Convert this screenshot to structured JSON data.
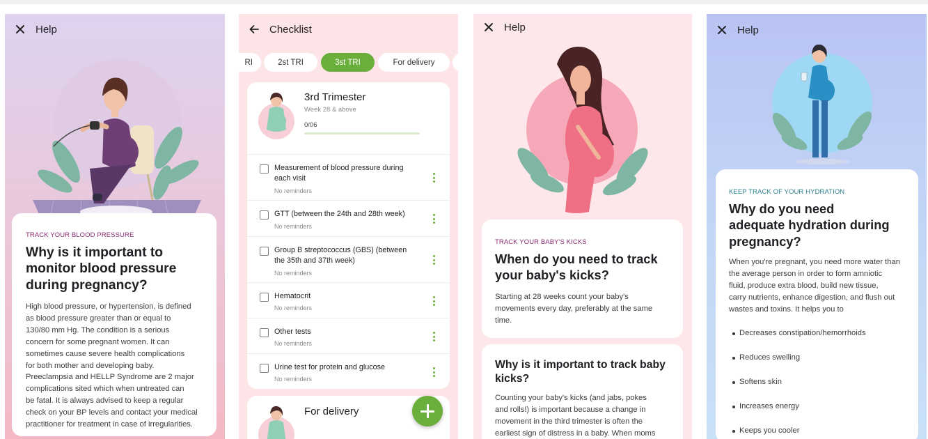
{
  "colors": {
    "green_accent": "#6aae3c",
    "purple_kicker": "#8a2d74",
    "teal_kicker": "#2a7f8f"
  },
  "screen1": {
    "title": "Help",
    "close_icon": "close-icon",
    "kicker": "TRACK YOUR BLOOD PRESSURE",
    "heading": [
      "Why is it important to",
      "monitor blood pressure",
      "during pregnancy?"
    ],
    "body": [
      "High blood pressure, or hypertension, is defined",
      "as blood pressure greater than or equal to",
      "130/80 mm Hg. The condition is a serious",
      "concern for some pregnant women. It can",
      "sometimes cause severe health complications",
      "for both mother and developing baby.",
      "Preeclampsia and HELLP Syndrome are 2 major",
      "complications sited which when untreated can",
      "be fatal. It is always advised to keep a regular",
      "check on your BP levels and contact your medical",
      "practitioner for treatment in case of irregularities."
    ]
  },
  "screen2": {
    "title": "Checklist",
    "back_icon": "arrow-left-icon",
    "tabs": [
      {
        "label": "RI",
        "active": false
      },
      {
        "label": "2st TRI",
        "active": false
      },
      {
        "label": "3st TRI",
        "active": true
      },
      {
        "label": "For delivery",
        "active": false
      }
    ],
    "trimester": {
      "title": "3rd Trimester",
      "subtitle": "Week 28 & above",
      "progress_text": "0/06",
      "progress_fraction": 0
    },
    "items": [
      {
        "title": "Measurement of blood pressure during each visit",
        "lines": [
          "Measurement of blood pressure during",
          "each visit"
        ],
        "reminder": "No reminders"
      },
      {
        "title": "GTT (between the 24th and 28th week)",
        "lines": [
          "GTT (between the 24th and 28th week)"
        ],
        "reminder": "No reminders"
      },
      {
        "title": "Group B streptococcus (GBS) (between the 35th and 37th week)",
        "lines": [
          "Group B streptococcus (GBS) (between",
          "the 35th and 37th week)"
        ],
        "reminder": "No reminders"
      },
      {
        "title": "Hematocrit",
        "lines": [
          "Hematocrit"
        ],
        "reminder": "No reminders"
      },
      {
        "title": "Other tests",
        "lines": [
          "Other tests"
        ],
        "reminder": "No reminders"
      },
      {
        "title": "Urine test for protein and glucose",
        "lines": [
          "Urine test for protein and glucose"
        ],
        "reminder": "No reminders"
      }
    ],
    "delivery_title": "For delivery",
    "fab_icon": "plus-icon"
  },
  "screen3": {
    "title": "Help",
    "close_icon": "close-icon",
    "kicker": "TRACK YOUR BABY'S KICKS",
    "heading": [
      "When do you need to track",
      "your baby's kicks?"
    ],
    "body": [
      "Starting at 28 weeks count your baby's",
      "movements every day, preferably at the same",
      "time."
    ],
    "heading2": [
      "Why is it important to track baby",
      "kicks?"
    ],
    "body2": [
      "Counting your baby's kicks (and jabs, pokes",
      "and rolls!) is important because a change in",
      "movement in the third trimester is often the",
      "earliest sign of distress in a baby. When moms"
    ]
  },
  "screen4": {
    "title": "Help",
    "close_icon": "close-icon",
    "kicker": "KEEP TRACK OF YOUR HYDRATION",
    "heading": [
      "Why do you need",
      "adequate hydration during",
      "pregnancy?"
    ],
    "body": [
      "When you're pregnant, you need more water than",
      "the average person in order to form amniotic",
      "fluid, produce extra blood, build new tissue,",
      "carry nutrients, enhance digestion, and flush out",
      "wastes and toxins. It helps you to"
    ],
    "bullets": [
      "Decreases constipation/hemorrhoids",
      "Reduces swelling",
      "Softens skin",
      "Increases energy",
      "Keeps you cooler"
    ]
  }
}
